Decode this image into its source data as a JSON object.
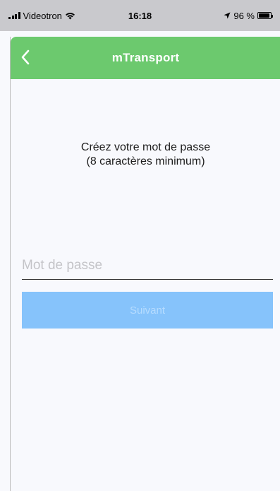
{
  "status_bar": {
    "carrier": "Videotron",
    "time": "16:18",
    "battery": "96 %",
    "battery_level": 0.96,
    "icons": [
      "signal-icon",
      "wifi-icon",
      "location-arrow-icon",
      "battery-icon"
    ]
  },
  "header": {
    "title": "mTransport",
    "back_icon": "chevron-left-icon"
  },
  "instructions": {
    "line1": "Créez votre mot de passe",
    "line2": "(8 caractères minimum)"
  },
  "password": {
    "placeholder": "Mot de passe",
    "value": ""
  },
  "next_button": {
    "label": "Suivant",
    "enabled": false
  },
  "colors": {
    "header_bg": "#6cc96e",
    "button_bg": "#86c3fb",
    "status_bar_bg": "#c9c9cd"
  }
}
